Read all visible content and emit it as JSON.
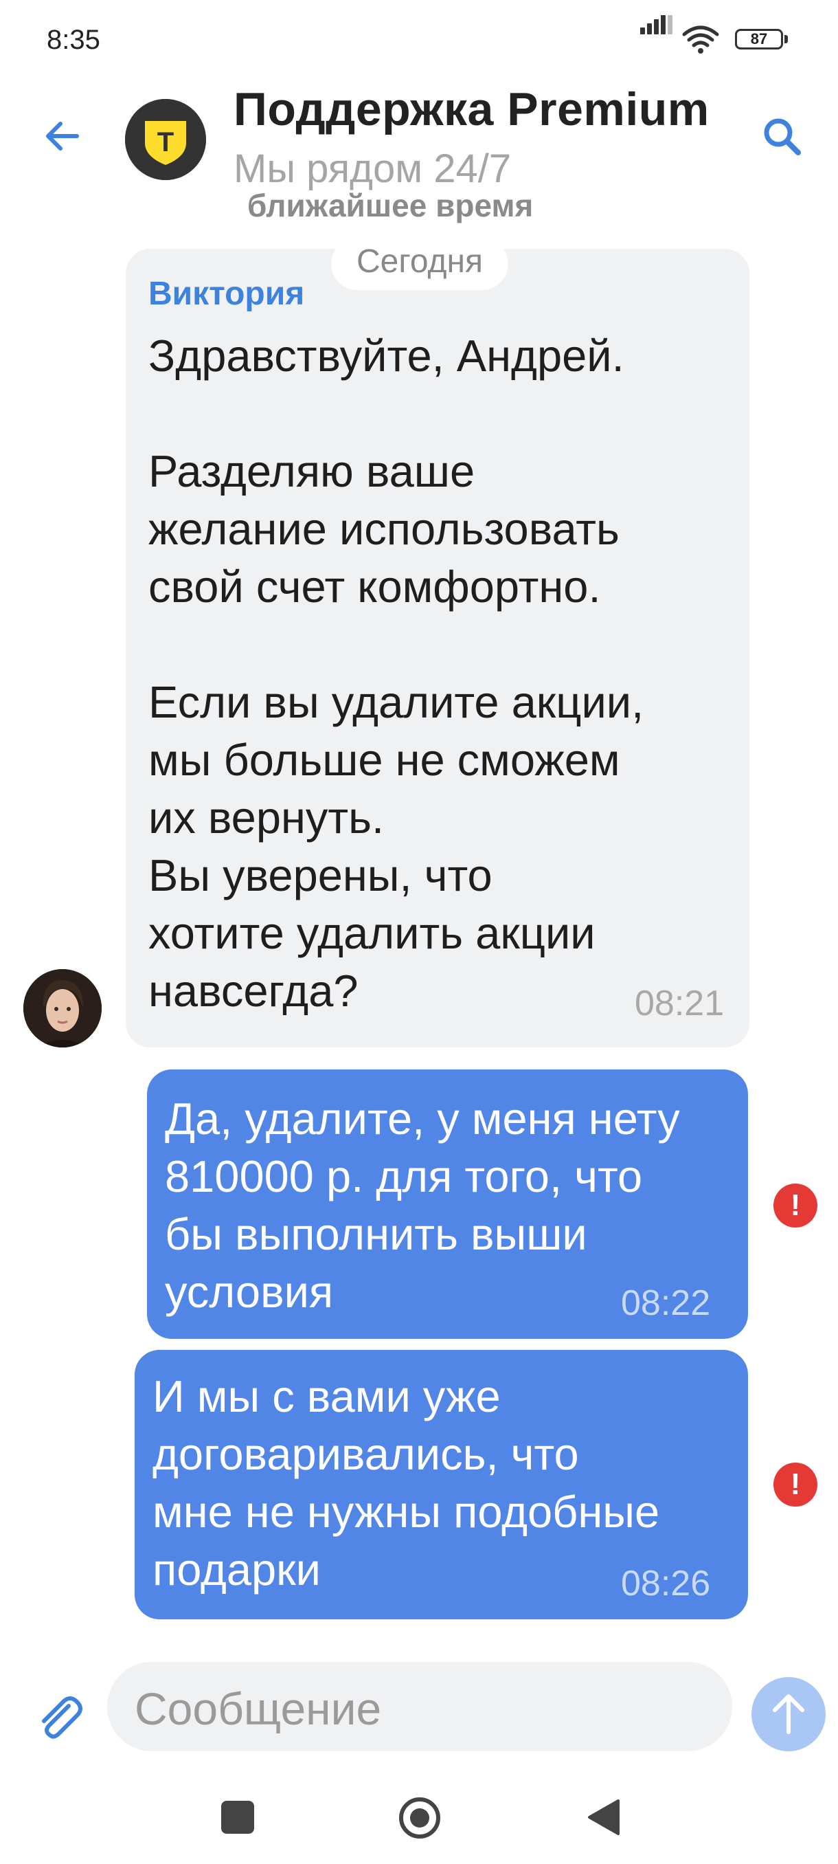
{
  "status_bar": {
    "time": "8:35",
    "battery": "87"
  },
  "header": {
    "title": "Поддержка Premium",
    "subtitle": "Мы рядом 24/7",
    "partial_subtitle": "ближайшее время",
    "avatar_letter": "Т",
    "brand_color": "#ffdd2d"
  },
  "chat": {
    "date_label": "Сегодня",
    "messages": [
      {
        "direction": "incoming",
        "sender": "Виктория",
        "text": "Здравствуйте, Андрей.\n\nРазделяю ваше\nжелание использовать\nсвой счет комфортно.\n\nЕсли вы удалите акции,\nмы больше не сможем\nих вернуть.\nВы уверены, что\nхотите удалить акции\nнавсегда?",
        "time": "08:21"
      },
      {
        "direction": "outgoing",
        "text": "Да, удалите, у меня нету\n810000 р. для того, что\nбы выполнить выши\nусловия",
        "time": "08:22",
        "error_mark": "!"
      },
      {
        "direction": "outgoing",
        "text": "И мы с вами уже\nдоговаривались, что\nмне не нужны подобные\nподарки",
        "time": "08:26",
        "error_mark": "!"
      }
    ]
  },
  "composer": {
    "placeholder": "Сообщение"
  },
  "colors": {
    "accent": "#3e82e0",
    "outgoing_bubble": "#5286e6",
    "incoming_bubble": "#f0f1f3",
    "error": "#e53935"
  }
}
